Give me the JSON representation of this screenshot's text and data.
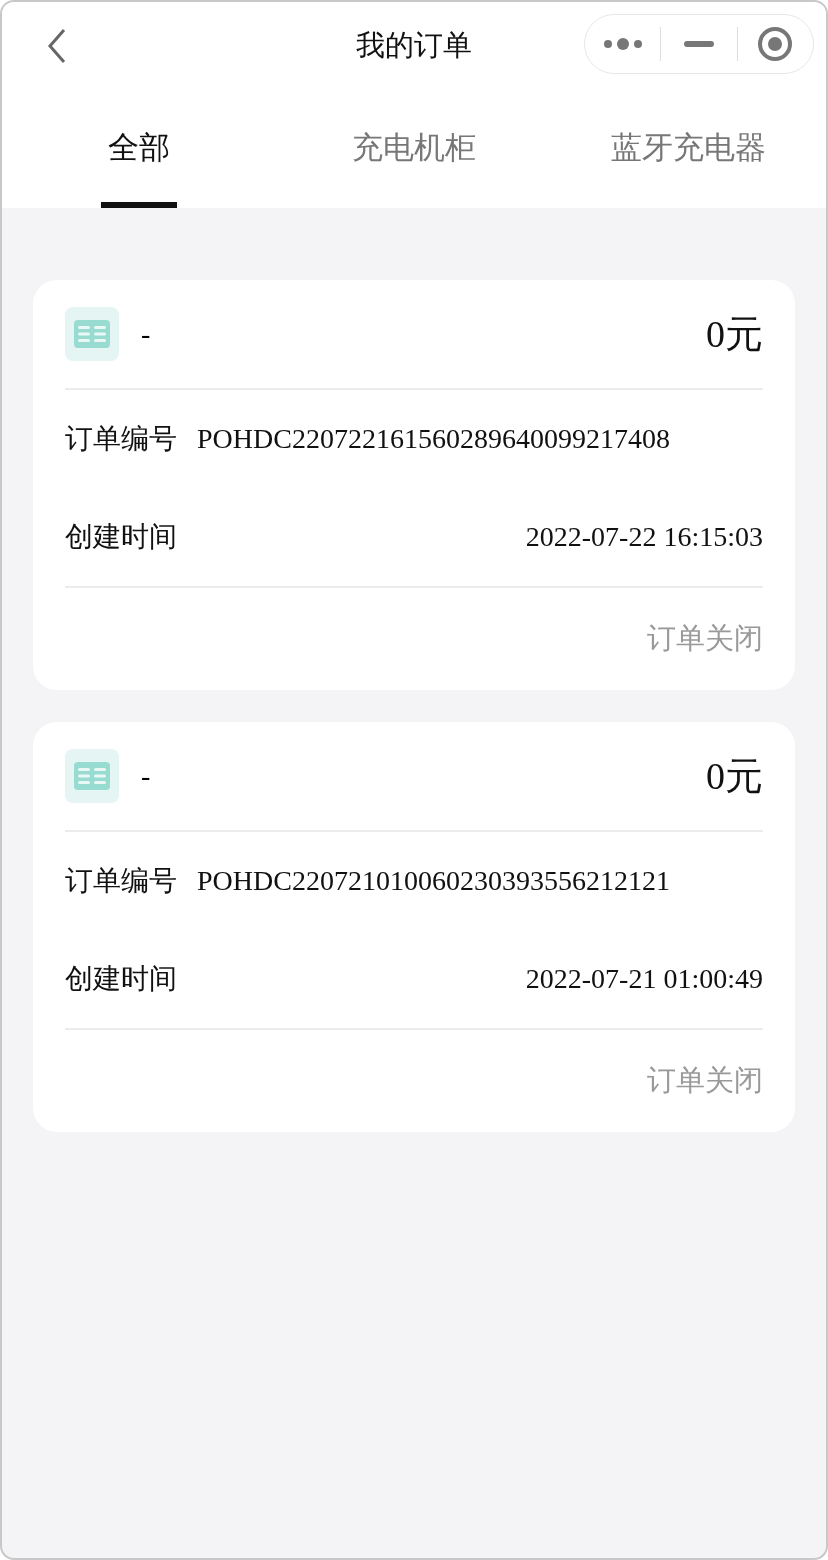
{
  "navbar": {
    "title": "我的订单"
  },
  "tabs": [
    {
      "label": "全部",
      "selected": true
    },
    {
      "label": "充电机柜",
      "selected": false
    },
    {
      "label": "蓝牙充电器",
      "selected": false
    }
  ],
  "orders": [
    {
      "name": "-",
      "amount": "0元",
      "number_label": "订单编号",
      "number": "POHDC220722161560289640099217408",
      "time_label": "创建时间",
      "time": "2022-07-22 16:15:03",
      "status": "订单关闭"
    },
    {
      "name": "-",
      "amount": "0元",
      "number_label": "订单编号",
      "number": "POHDC220721010060230393556212121",
      "time_label": "创建时间",
      "time": "2022-07-21 01:00:49",
      "status": "订单关闭"
    }
  ]
}
